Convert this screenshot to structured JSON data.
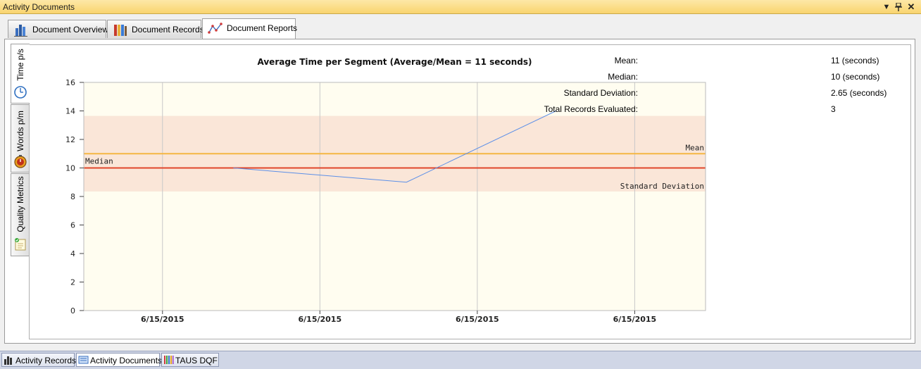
{
  "window": {
    "title": "Activity Documents",
    "controls": [
      "▼",
      "📌",
      "✕"
    ]
  },
  "tabs": [
    {
      "label": "Document Overview",
      "icon": "bar-chart-icon",
      "active": false
    },
    {
      "label": "Document Records",
      "icon": "binders-icon",
      "active": false
    },
    {
      "label": "Document Reports",
      "icon": "line-graph-icon",
      "active": true
    }
  ],
  "side_tabs": [
    {
      "label": "Time p/s",
      "icon": "clock-icon",
      "active": true
    },
    {
      "label": "Words p/m",
      "icon": "stopwatch-icon",
      "active": false
    },
    {
      "label": "Quality Metrics",
      "icon": "checklist-icon",
      "active": false
    }
  ],
  "stats": [
    {
      "label": "Mean:",
      "value": "11 (seconds)"
    },
    {
      "label": "Median:",
      "value": "10 (seconds)"
    },
    {
      "label": "Standard Deviation:",
      "value": "2.65 (seconds)"
    },
    {
      "label": "Total Records Evaluated:",
      "value": "3"
    }
  ],
  "bottom_tabs": [
    {
      "label": "Activity Records",
      "icon": "bar-chart-icon",
      "active": false
    },
    {
      "label": "Activity Documents",
      "icon": "documents-icon",
      "active": true
    },
    {
      "label": "TAUS DQF",
      "icon": "color-bars-icon",
      "active": false
    }
  ],
  "chart_data": {
    "type": "line",
    "title": "Average Time per Segment (Average/Mean = 11 seconds)",
    "xlabel": "",
    "ylabel": "",
    "ylim": [
      0,
      16
    ],
    "yticks": [
      0,
      2,
      4,
      6,
      8,
      10,
      12,
      14,
      16
    ],
    "x_tick_labels": [
      "6/15/2015",
      "6/15/2015",
      "6/15/2015",
      "6/15/2015"
    ],
    "x_tick_positions": [
      0.5,
      1.5,
      2.5,
      3.5
    ],
    "xlim": [
      0,
      3.95
    ],
    "series": [
      {
        "values": [
          {
            "x": 0.95,
            "y": 10
          },
          {
            "x": 2.05,
            "y": 9
          },
          {
            "x": 3.0,
            "y": 14
          }
        ],
        "color": "#5b8fe8"
      }
    ],
    "reference_lines": [
      {
        "label": "Mean",
        "value": 11,
        "color": "#f5b642"
      },
      {
        "label": "Median",
        "value": 10,
        "color": "#e0452a"
      }
    ],
    "band": {
      "label": "Standard Deviation",
      "from": 8.35,
      "to": 13.65,
      "color": "#fae6d8"
    },
    "plot_background": "#fffdf0",
    "grid": true
  }
}
